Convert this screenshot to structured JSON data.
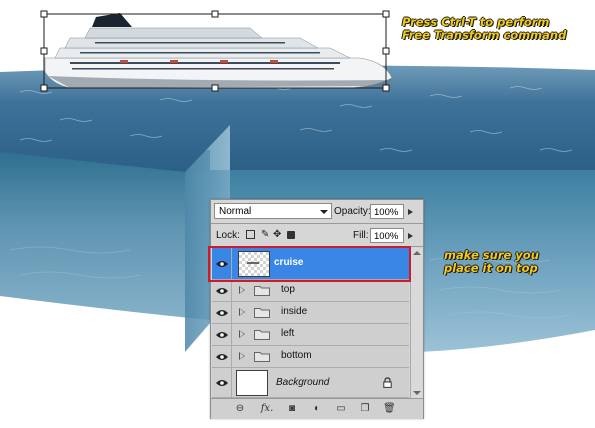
{
  "annotations": {
    "transform": [
      "Press Ctrl-T to perform",
      "Free Transform command"
    ],
    "placement": [
      "make sure you",
      "place it on top"
    ]
  },
  "layers_panel": {
    "blend_mode": "Normal",
    "opacity_label": "Opacity:",
    "opacity_value": "100%",
    "lock_label": "Lock:",
    "fill_label": "Fill:",
    "fill_value": "100%",
    "layers": [
      {
        "name": "cruise",
        "type": "layer",
        "selected": true,
        "visible": true
      },
      {
        "name": "top",
        "type": "group",
        "visible": true
      },
      {
        "name": "inside",
        "type": "group",
        "visible": true
      },
      {
        "name": "left",
        "type": "group",
        "visible": true
      },
      {
        "name": "bottom",
        "type": "group",
        "visible": true
      },
      {
        "name": "Background",
        "type": "background",
        "locked": true,
        "visible": true
      }
    ],
    "footer_icons": [
      "link-icon",
      "fx-icon",
      "mask-icon",
      "adjustment-icon",
      "new-group-icon",
      "new-layer-icon",
      "trash-icon"
    ],
    "footer_fx": "fx."
  },
  "colors": {
    "selection": "#3a86e6",
    "highlight_box": "#cf1a2c",
    "annotation": "#f3cc1a"
  }
}
